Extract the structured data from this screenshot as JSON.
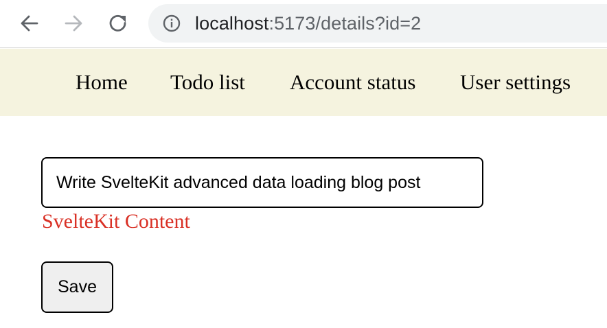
{
  "browser": {
    "back_icon": "arrow-left-icon",
    "forward_icon": "arrow-right-icon",
    "reload_icon": "reload-icon",
    "info_icon": "info-icon",
    "url_host": "localhost",
    "url_path": ":5173/details?id=2"
  },
  "nav": {
    "items": [
      {
        "label": "Home"
      },
      {
        "label": "Todo list"
      },
      {
        "label": "Account status"
      },
      {
        "label": "User settings"
      }
    ],
    "background": "#f5f3df"
  },
  "form": {
    "title_value": "Write SvelteKit advanced data loading blog post",
    "content_label": "SvelteKit Content",
    "content_label_color": "#d93025",
    "save_label": "Save"
  }
}
